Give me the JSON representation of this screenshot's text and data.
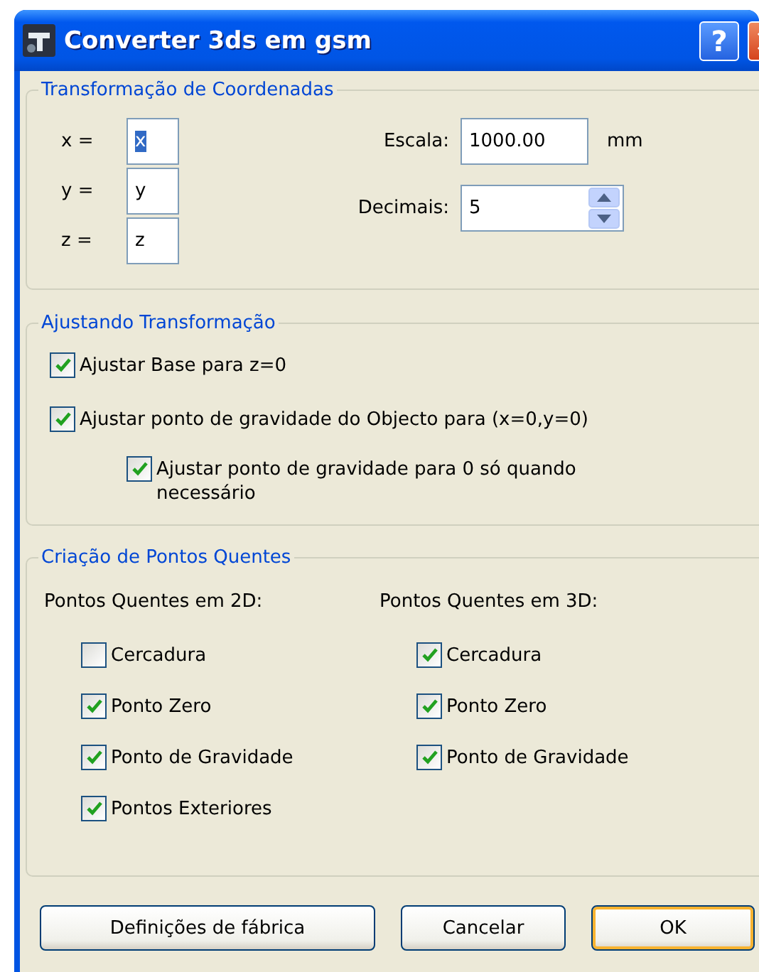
{
  "window": {
    "title": "Converter 3ds em gsm",
    "help_button": "?"
  },
  "coordinates": {
    "legend": "Transformação de Coordenadas",
    "axes": [
      {
        "label": "x =",
        "value": "x",
        "selected": true
      },
      {
        "label": "y =",
        "value": "y",
        "selected": false
      },
      {
        "label": "z =",
        "value": "z",
        "selected": false
      }
    ],
    "scale": {
      "label": "Escala:",
      "value": "1000.00",
      "unit": "mm"
    },
    "decimals": {
      "label": "Decimais:",
      "value": "5"
    }
  },
  "adjust": {
    "legend": "Ajustando Transformação",
    "options": [
      {
        "label": "Ajustar Base para z=0",
        "checked": true
      },
      {
        "label": "Ajustar ponto de gravidade do Objecto para (x=0,y=0)",
        "checked": true,
        "children": [
          {
            "label": "Ajustar ponto de gravidade para 0 só quando necessário",
            "checked": true
          }
        ]
      }
    ]
  },
  "hotspots": {
    "legend": "Criação de Pontos Quentes",
    "columns": [
      {
        "heading": "Pontos Quentes em 2D:",
        "options": [
          {
            "label": "Cercadura",
            "checked": false
          },
          {
            "label": "Ponto Zero",
            "checked": true
          },
          {
            "label": "Ponto de Gravidade",
            "checked": true
          },
          {
            "label": "Pontos Exteriores",
            "checked": true
          }
        ]
      },
      {
        "heading": "Pontos Quentes em 3D:",
        "options": [
          {
            "label": "Cercadura",
            "checked": true
          },
          {
            "label": "Ponto Zero",
            "checked": true
          },
          {
            "label": "Ponto de Gravidade",
            "checked": true
          }
        ]
      }
    ]
  },
  "buttons": [
    {
      "label": "Definições de fábrica",
      "default": false
    },
    {
      "label": "Cancelar",
      "default": false
    },
    {
      "label": "OK",
      "default": true
    }
  ]
}
